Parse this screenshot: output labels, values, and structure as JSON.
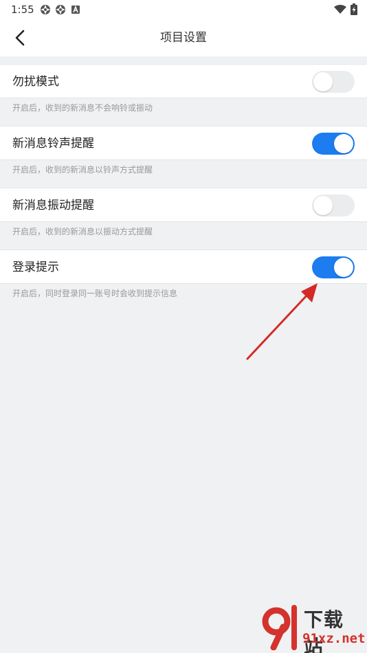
{
  "status_bar": {
    "time": "1:55",
    "left_icons": [
      "aperture-icon",
      "aperture-icon",
      "font-a-icon"
    ],
    "right_icons": [
      "wifi-icon",
      "battery-charging-icon"
    ]
  },
  "header": {
    "title": "项目设置"
  },
  "settings": [
    {
      "label": "勿扰模式",
      "description": "开启后，收到的新消息不会响铃或振动",
      "enabled": false
    },
    {
      "label": "新消息铃声提醒",
      "description": "开启后，收到的新消息以铃声方式提醒",
      "enabled": true
    },
    {
      "label": "新消息振动提醒",
      "description": "开启后，收到的新消息以振动方式提醒",
      "enabled": false
    },
    {
      "label": "登录提示",
      "description": "开启后，同时登录同一账号时会收到提示信息",
      "enabled": true
    }
  ],
  "colors": {
    "accent": "#1c7cf0",
    "toggle_off": "#ebecee",
    "annotation_arrow": "#d42a26"
  },
  "watermark": {
    "logo": "91",
    "text": "下载站",
    "url": "91xz.net"
  }
}
